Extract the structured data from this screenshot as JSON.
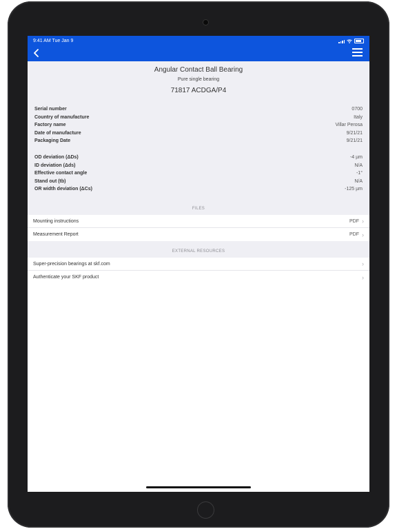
{
  "status_bar": {
    "time": "9:41 AM  Tue Jan 9"
  },
  "header": {
    "product_type": "Angular Contact Ball Bearing",
    "arrangement": "Pure single bearing",
    "designation": "71817 ACDGA/P4"
  },
  "details_a": [
    {
      "label": "Serial number",
      "value": "0700"
    },
    {
      "label": "Country of manufacture",
      "value": "Italy"
    },
    {
      "label": "Factory name",
      "value": "Villar Perosa"
    },
    {
      "label": "Date of manufacture",
      "value": "9/21/21"
    },
    {
      "label": "Packaging Date",
      "value": "9/21/21"
    }
  ],
  "details_b": [
    {
      "label": "OD deviation (ΔDs)",
      "value": "-4 µm"
    },
    {
      "label": "ID deviation (Δds)",
      "value": "N/A"
    },
    {
      "label": "Effective contact angle",
      "value": "-1°"
    },
    {
      "label": "Stand out (tb)",
      "value": "N/A"
    },
    {
      "label": "OR width deviation (ΔCs)",
      "value": "-125 µm"
    }
  ],
  "files": {
    "header": "FILES",
    "items": [
      {
        "label": "Mounting instructions",
        "badge": "PDF"
      },
      {
        "label": "Measurement Report",
        "badge": "PDF"
      }
    ]
  },
  "external": {
    "header": "EXTERNAL RESOURCES",
    "items": [
      {
        "label": "Super-precision bearings at skf.com"
      },
      {
        "label": "Authenticate your SKF product"
      }
    ]
  },
  "colors": {
    "accent": "#0d55dd",
    "background": "#efeff4"
  },
  "icons": [
    "back-chevron-icon",
    "hamburger-menu-icon",
    "wifi-icon",
    "battery-icon",
    "chevron-right-icon"
  ]
}
